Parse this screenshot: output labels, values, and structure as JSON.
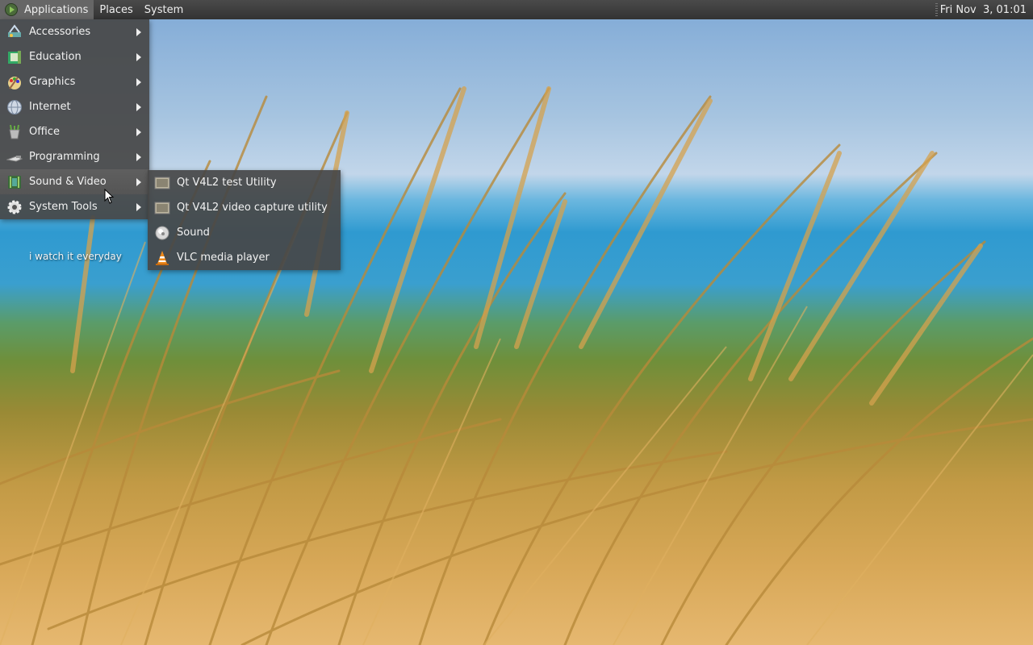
{
  "top_panel": {
    "menus": [
      "Applications",
      "Places",
      "System"
    ],
    "clock": "Fri Nov  3, 01:01"
  },
  "app_menu": {
    "items": [
      {
        "label": "Accessories",
        "icon": "accessories-icon"
      },
      {
        "label": "Education",
        "icon": "education-icon"
      },
      {
        "label": "Graphics",
        "icon": "graphics-icon"
      },
      {
        "label": "Internet",
        "icon": "internet-icon"
      },
      {
        "label": "Office",
        "icon": "office-icon"
      },
      {
        "label": "Programming",
        "icon": "programming-icon"
      },
      {
        "label": "Sound & Video",
        "icon": "sound-video-icon",
        "active": true
      },
      {
        "label": "System Tools",
        "icon": "system-tools-icon"
      }
    ]
  },
  "sub_menu": {
    "items": [
      {
        "label": "Qt V4L2 test Utility",
        "icon": "qt-v4l2-icon"
      },
      {
        "label": "Qt V4L2 video capture utility",
        "icon": "qt-v4l2-capture-icon"
      },
      {
        "label": "Sound",
        "icon": "sound-icon"
      },
      {
        "label": "VLC media player",
        "icon": "vlc-icon"
      }
    ]
  },
  "desktop": {
    "label": "i watch it everyday"
  },
  "colors": {
    "panel_bg": "#3c3c3c",
    "menu_bg": "#464646",
    "active_item": "#5a5a5a",
    "text": "#f2f2f2"
  }
}
